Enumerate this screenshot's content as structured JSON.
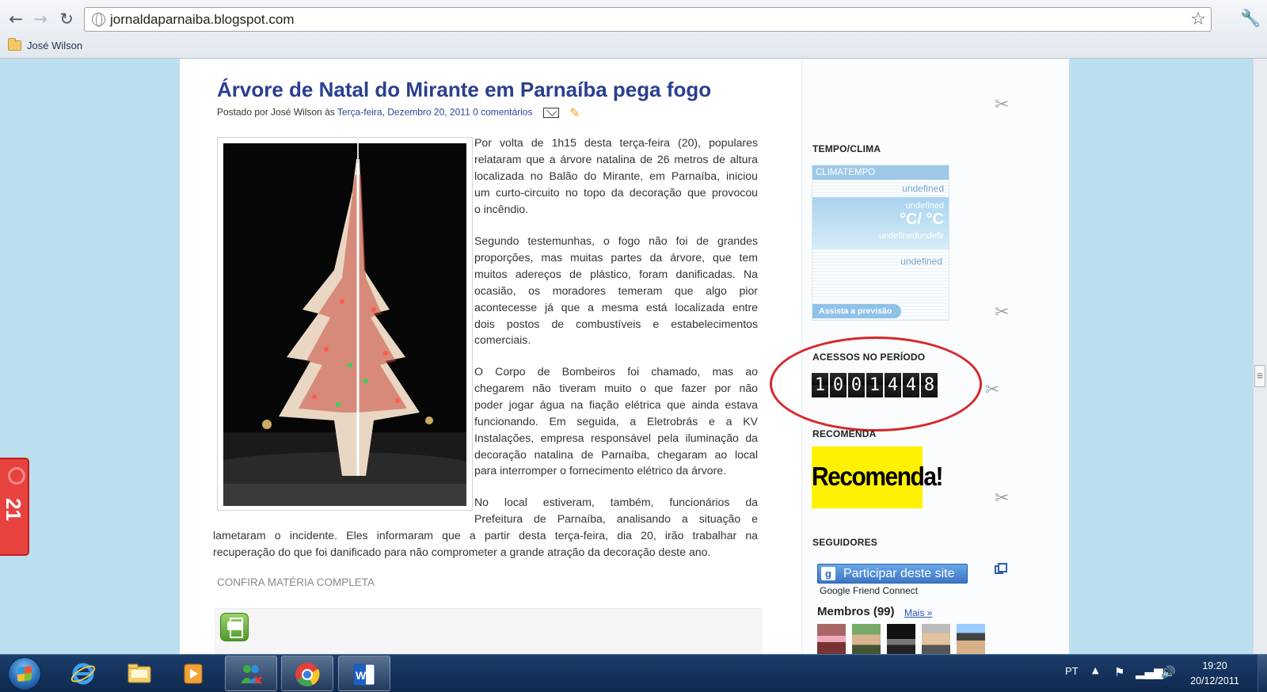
{
  "browser": {
    "url": "jornaldaparnaiba.blogspot.com",
    "bookmark_label": "José Wilson"
  },
  "post": {
    "title": "Árvore de Natal do Mirante em Parnaíba pega fogo",
    "meta_prefix": "Postado por José Wilson",
    "meta_at": "às",
    "meta_date": "Terça-feira, Dezembro 20, 2011",
    "meta_comments": "0 comentários",
    "p1": [
      "Por volta de 1h15 desta terça-feira (20), populares",
      "relataram que a árvore natalina de 26 metros de altura",
      "localizada no Balão do Mirante, em Parnaíba, iniciou",
      "um curto-circuito no topo da decoração que provocou",
      "o incêndio."
    ],
    "p2": [
      "Segundo testemunhas, o fogo não foi de grandes",
      "proporções, mas muitas partes da árvore, que tem",
      "muitos adereços de plástico, foram danificadas. Na",
      "ocasião, os moradores temeram que algo pior",
      "acontecesse já que a mesma está localizada entre",
      "dois postos de combustíveis e estabelecimentos",
      "comerciais."
    ],
    "p3": [
      "O Corpo de Bombeiros foi chamado, mas ao",
      "chegarem não tiveram muito o que fazer por não",
      "poder jogar água na fiação elétrica que ainda estava",
      "funcionando. Em seguida, a Eletrobrás e a KV",
      "Instalações, empresa responsável pela iluminação da",
      "decoração natalina de Parnaíba, chegaram ao local",
      "para interromper o fornecimento elétrico da árvore."
    ],
    "p4": [
      "No local estiveram, também, funcionários da",
      "Prefeitura de Parnaíba, analisando a situação e"
    ],
    "p4_full": [
      "lametaram o incidente. Eles informaram que a partir desta terça-feira, dia 20, irão trabalhar na",
      "recuperação do que foi danificado para não comprometer a grande atração da decoração deste ano."
    ],
    "confira": "CONFIRA MATÉRIA COMPLETA"
  },
  "sidebar": {
    "tempo_title": "TEMPO/CLIMA",
    "clima": {
      "brand": "CLIMATEMPO",
      "location": "undefined",
      "small": "undefined",
      "temp": "°C/ °C",
      "sub": "undefinedundefir",
      "low": "undefined",
      "button": "Assista a previsão"
    },
    "acessos_title": "ACESSOS NO PERÍODO",
    "counter_digits": [
      "1",
      "0",
      "0",
      "1",
      "4",
      "4",
      "8"
    ],
    "recomenda_title": "RECOMENDA",
    "recomenda_img": "Recomenda!",
    "seguidores_title": "SEGUIDORES",
    "gfc_button": "Participar deste site",
    "gfc_text": "Google Friend Connect",
    "membros": "Membros (99)",
    "mais": "Mais »"
  },
  "side_tab_label": "21",
  "taskbar": {
    "lang": "PT",
    "time": "19:20",
    "date": "20/12/2011"
  },
  "colors": {
    "page_bg": "#bcdff0",
    "title_blue": "#2a3f8e",
    "counter_ring": "#d8262b",
    "recomenda_yellow": "#fff200"
  }
}
